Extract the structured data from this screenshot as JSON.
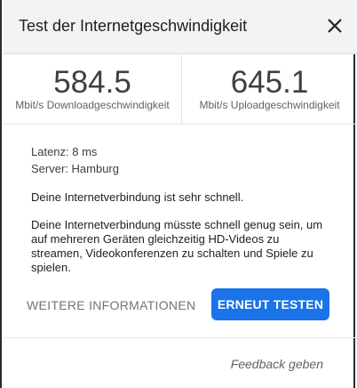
{
  "dialog": {
    "title": "Test der Internetgeschwindigkeit",
    "close_icon": "close-icon"
  },
  "download": {
    "value": "584.5",
    "label": "Mbit/s Downloadgeschwindigkeit"
  },
  "upload": {
    "value": "645.1",
    "label": "Mbit/s Uploadgeschwindigkeit"
  },
  "details": {
    "latency": "Latenz: 8 ms",
    "server": "Server: Hamburg"
  },
  "messages": {
    "summary": "Deine Internetverbindung ist sehr schnell.",
    "description": "Deine Internetverbindung müsste schnell genug sein, um auf mehreren Geräten gleichzeitig HD-Videos zu streamen, Videokonferenzen zu schalten und Spiele zu spielen."
  },
  "actions": {
    "more_info": "WEITERE INFORMATIONEN",
    "retest": "ERNEUT TESTEN",
    "feedback": "Feedback geben"
  },
  "colors": {
    "accent": "#1a73e8",
    "header_bg": "#f1f3f4"
  }
}
